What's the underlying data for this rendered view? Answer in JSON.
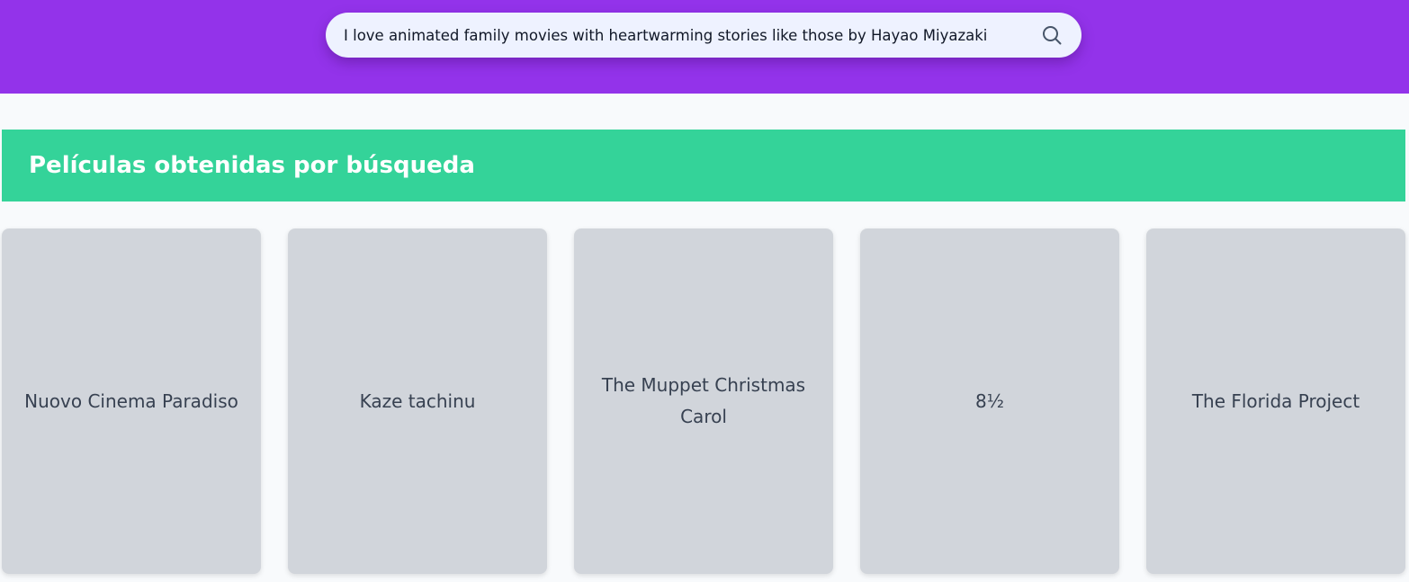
{
  "search": {
    "value": "I love animated family movies with heartwarming stories like those by Hayao Miyazaki",
    "icon": "search-icon"
  },
  "section": {
    "title": "Películas obtenidas por búsqueda"
  },
  "movies": [
    {
      "title": "Nuovo Cinema Paradiso"
    },
    {
      "title": "Kaze tachinu"
    },
    {
      "title": "The Muppet Christmas Carol"
    },
    {
      "title": "8½"
    },
    {
      "title": "The Florida Project"
    }
  ],
  "colors": {
    "header": "#9333ea",
    "section_bar": "#34d399",
    "card": "#d1d5db",
    "background": "#f8fafc"
  }
}
